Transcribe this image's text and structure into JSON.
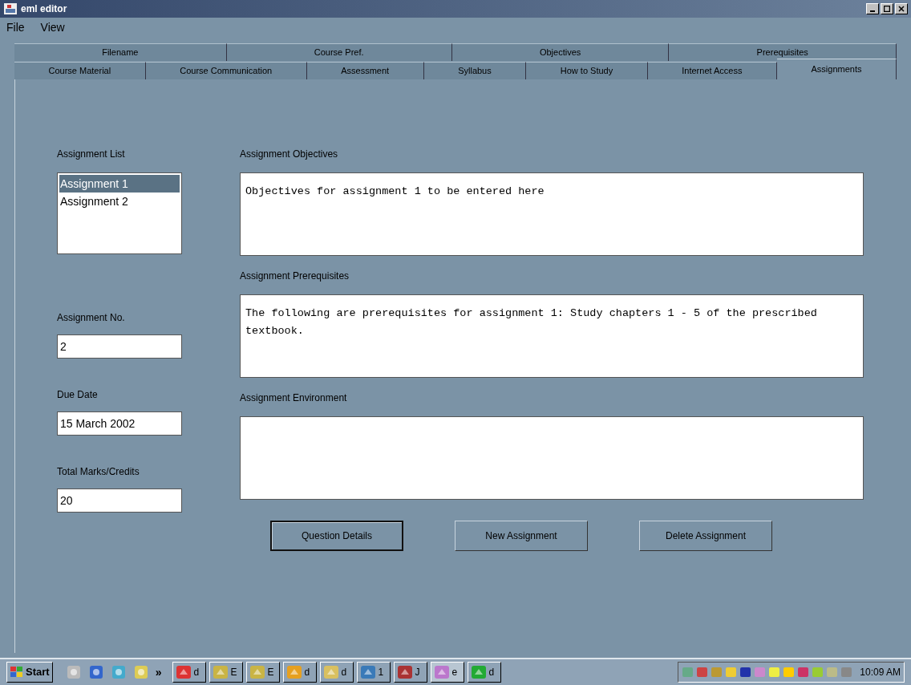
{
  "window": {
    "title": "eml editor"
  },
  "menu": [
    "File",
    "View"
  ],
  "tab_rows": [
    [
      {
        "label": "Filename",
        "selected": false
      },
      {
        "label": "Course Pref.",
        "selected": false
      },
      {
        "label": "Objectives",
        "selected": false
      },
      {
        "label": "Prerequisites",
        "selected": false
      }
    ],
    [
      {
        "label": "Course Material",
        "selected": false
      },
      {
        "label": "Course Communication",
        "selected": false
      },
      {
        "label": "Assessment",
        "selected": false
      },
      {
        "label": "Syllabus",
        "selected": false
      },
      {
        "label": "How to Study",
        "selected": false
      },
      {
        "label": "Internet Access",
        "selected": false
      },
      {
        "label": "Assignments",
        "selected": true
      }
    ]
  ],
  "assignment_list": {
    "label": "Assignment List",
    "items": [
      {
        "label": "Assignment 1",
        "selected": true
      },
      {
        "label": "Assignment 2",
        "selected": false
      }
    ]
  },
  "fields": [
    {
      "label": "Assignment No.",
      "value": "2"
    },
    {
      "label": "Due Date",
      "value": "15 March 2002"
    },
    {
      "label": "Total Marks/Credits",
      "value": "20"
    }
  ],
  "text_areas": [
    {
      "label": "Assignment Objectives",
      "value": "Objectives for assignment 1 to be entered here"
    },
    {
      "label": "Assignment Prerequisites",
      "value": "The following are prerequisites for assignment 1: Study chapters 1 - 5 of the prescribed textbook."
    },
    {
      "label": "Assignment Environment"
    }
  ],
  "buttons": [
    {
      "label": "Question Details",
      "selected": true
    },
    {
      "label": "New Assignment",
      "selected": false
    },
    {
      "label": "Delete Assignment",
      "selected": false
    }
  ],
  "taskbar": {
    "start": "Start",
    "more": "»",
    "tasks": [
      "d",
      "E",
      "E",
      "d",
      "d",
      "1",
      "J",
      "e",
      "d"
    ],
    "clock": "10:09 AM"
  }
}
